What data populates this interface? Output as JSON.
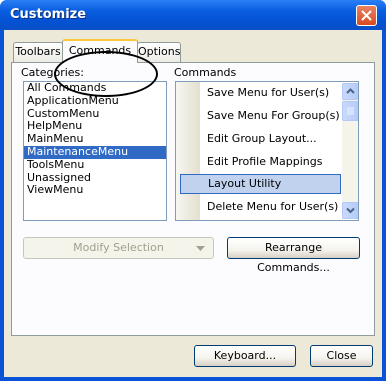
{
  "window": {
    "title": "Customize"
  },
  "tabs": [
    {
      "label": "Toolbars"
    },
    {
      "label": "Commands"
    },
    {
      "label": "Options"
    }
  ],
  "categories": {
    "label": "Categories:",
    "items": [
      "All Commands",
      "ApplicationMenu",
      "CustomMenu",
      "HelpMenu",
      "MainMenu",
      "MaintenanceMenu",
      "ToolsMenu",
      "Unassigned",
      "ViewMenu"
    ],
    "selected": "MaintenanceMenu"
  },
  "commands": {
    "label": "Commands",
    "items": [
      "Save Menu for User(s)",
      "Save Menu For Group(s)",
      "Edit Group Layout...",
      "Edit Profile Mappings",
      "Layout Utility",
      "Delete Menu for User(s)"
    ],
    "selected": "Layout Utility"
  },
  "buttons": {
    "modify_selection": "Modify Selection",
    "rearrange": "Rearrange Commands...",
    "keyboard": "Keyboard...",
    "close": "Close"
  },
  "colors": {
    "title_bar": "#0a5ee0",
    "selection": "#316ac5",
    "tab_highlight": "#ffc73c"
  }
}
